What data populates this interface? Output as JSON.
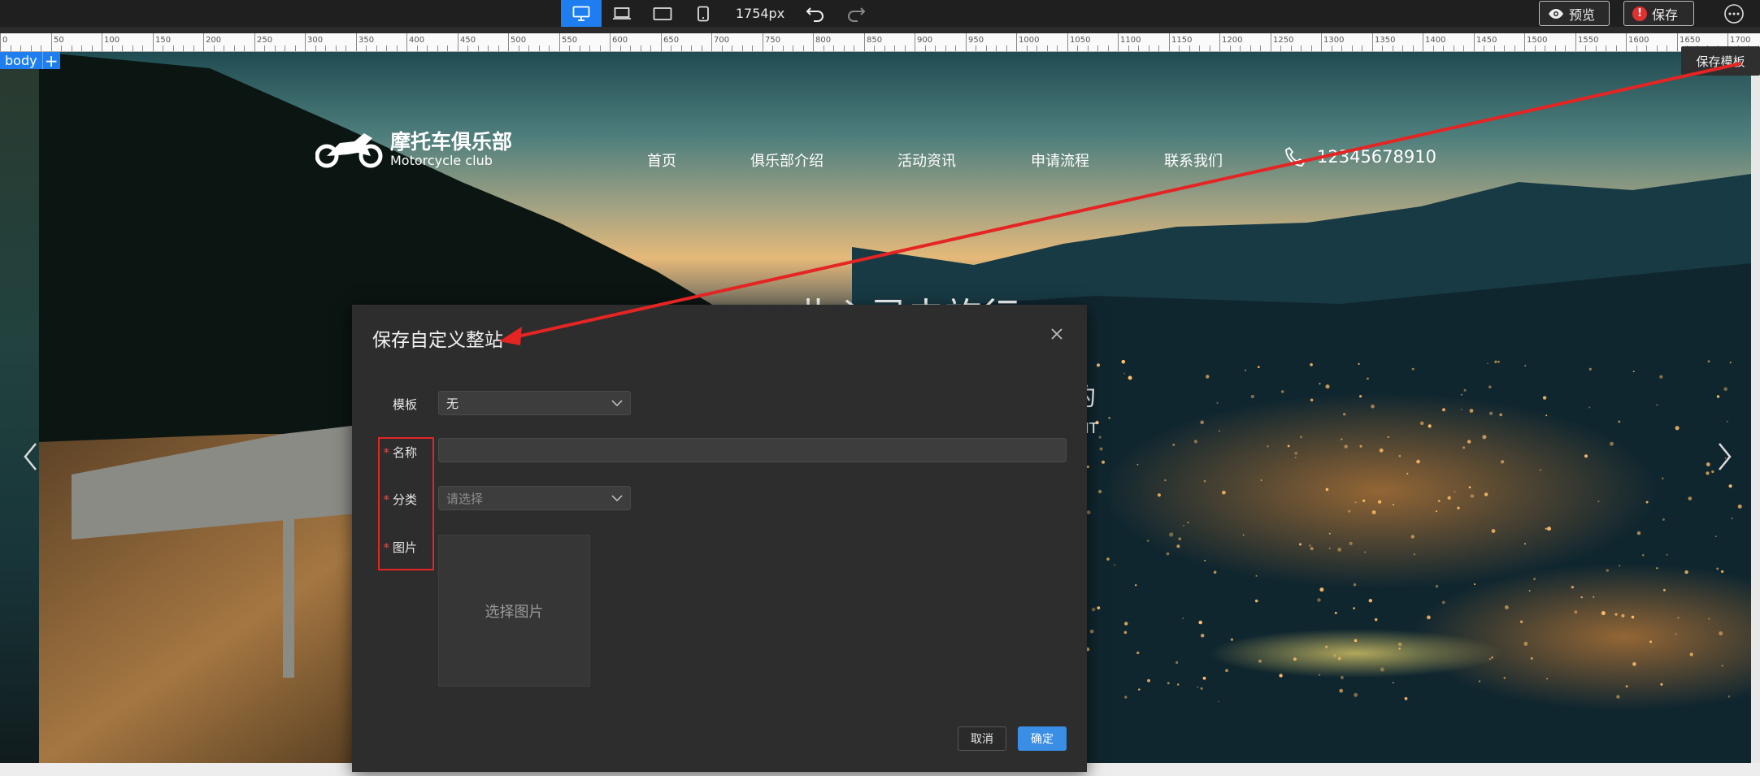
{
  "toolbar": {
    "width_readout": "1754px",
    "preview_label": "预览",
    "save_label": "保存",
    "save_alert_mark": "!"
  },
  "ruler": {
    "labels": [
      "0",
      "50",
      "100",
      "150",
      "200",
      "250",
      "300",
      "350",
      "400",
      "450",
      "500",
      "550",
      "600",
      "650",
      "700",
      "750",
      "800",
      "850",
      "900",
      "950",
      "1000",
      "1050",
      "1100",
      "1150",
      "1200",
      "1250",
      "1300",
      "1350",
      "1400",
      "1450",
      "1500",
      "1550",
      "1600",
      "1650",
      "1700"
    ]
  },
  "canvas": {
    "body_tag": "body",
    "body_add": "+",
    "save_template_tip": "保存模板"
  },
  "site": {
    "logo_title": "摩托车俱乐部",
    "logo_subtitle": "Motorcycle club",
    "nav": [
      "首页",
      "俱乐部介绍",
      "活动资讯",
      "申请流程",
      "联系我们"
    ],
    "phone": "12345678910",
    "hero_fragment_1": "此心灵去旅行",
    "hero_fragment_2": "的",
    "hero_fragment_3": "ANT"
  },
  "modal": {
    "title": "保存自定义整站",
    "template_label": "模板",
    "template_value": "无",
    "name_label": "名称",
    "name_value": "",
    "category_label": "分类",
    "category_placeholder": "请选择",
    "image_label": "图片",
    "image_picker_label": "选择图片",
    "required_mark": "*",
    "cancel_label": "取消",
    "confirm_label": "确定"
  },
  "colors": {
    "accent": "#1e7ef0",
    "confirm": "#3a8ee6",
    "annotation_red": "#e52424",
    "modal_bg": "#2d2d2d"
  }
}
